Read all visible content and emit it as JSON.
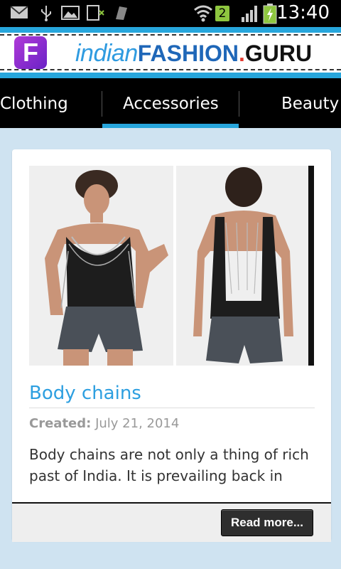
{
  "status_bar": {
    "time": "13:40",
    "notification_count": "2",
    "icons": [
      "mail-icon",
      "usb-icon",
      "image-icon",
      "download-icon",
      "app-icon",
      "wifi-icon",
      "signal-icon",
      "battery-charging-icon"
    ]
  },
  "header": {
    "brand_part1": "indian",
    "brand_part2": "FASHION",
    "brand_part3": ".",
    "brand_part4": "GURU",
    "logo_letter": "F",
    "accent_color": "#27a6dc"
  },
  "nav": {
    "items": [
      {
        "label": "Clothing"
      },
      {
        "label": "Accessories",
        "active": true
      },
      {
        "label": "Beauty"
      }
    ]
  },
  "article": {
    "title": "Body chains",
    "created_label": "Created:",
    "created_date": "July 21, 2014",
    "excerpt": "Body chains are not only a thing of rich past of India. It is prevailing back in",
    "read_more_label": "Read more..."
  }
}
